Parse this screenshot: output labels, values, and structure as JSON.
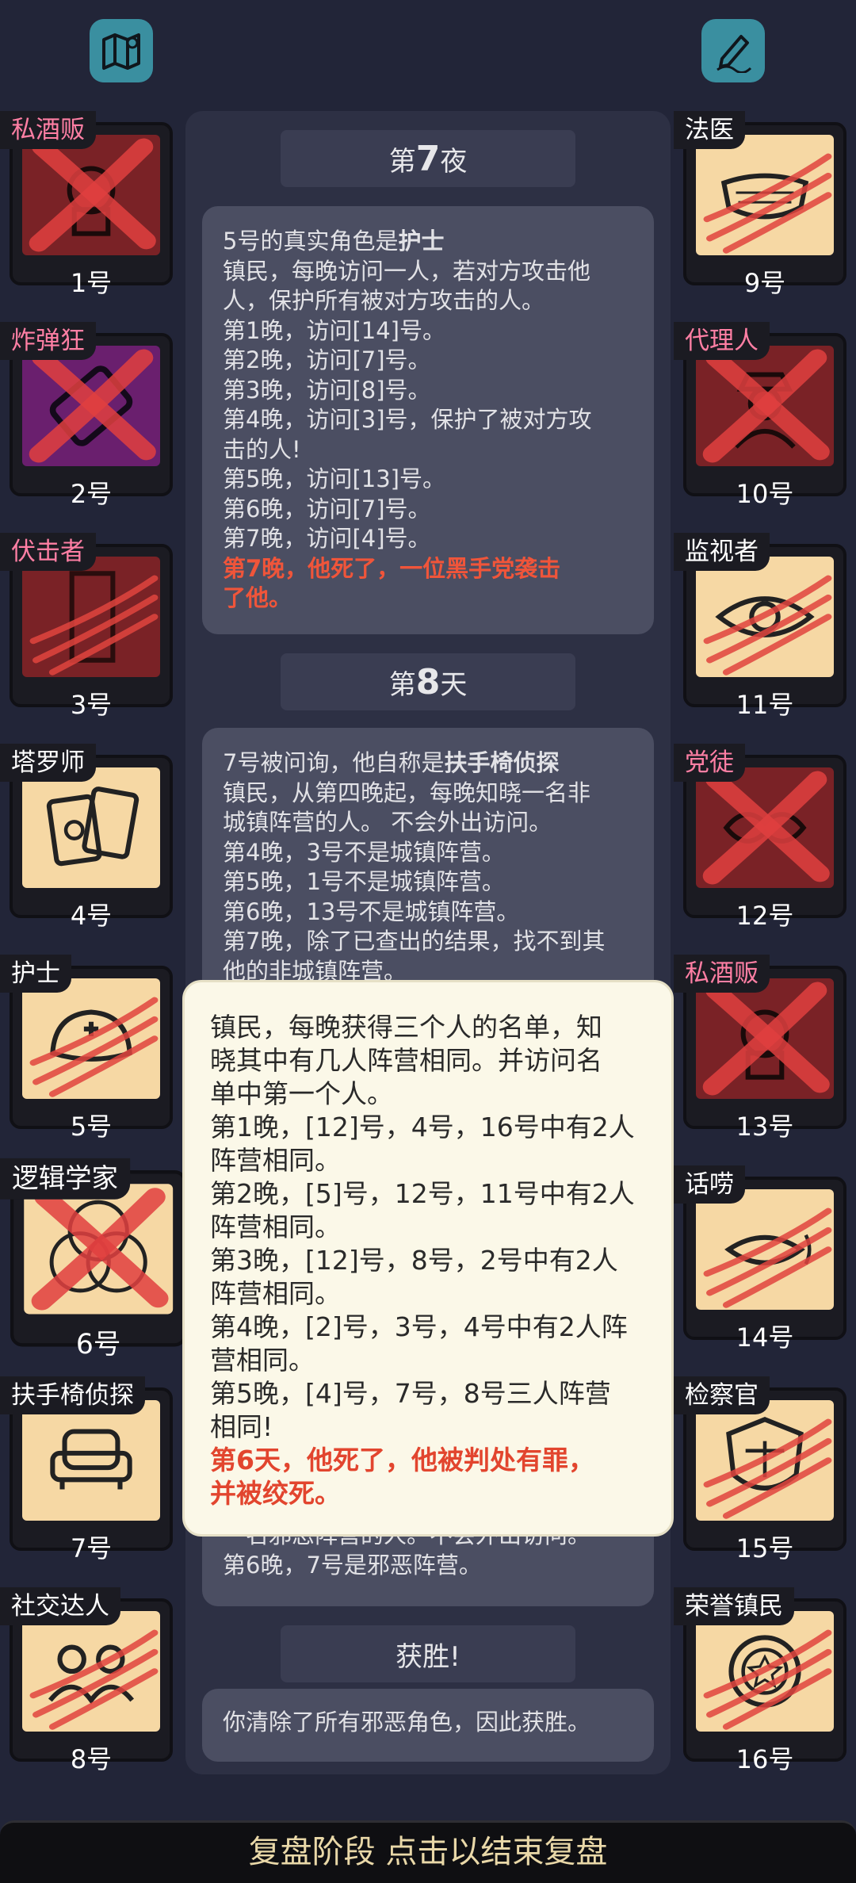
{
  "top": {
    "map_icon": "map-icon",
    "notes_icon": "pencil-icon"
  },
  "sections": [
    {
      "prefix": "第",
      "num": "7",
      "suffix": "夜"
    },
    {
      "prefix": "第",
      "num": "8",
      "suffix": "天"
    },
    {
      "title": "获胜!"
    }
  ],
  "night7": {
    "head_pre": "5号的真实角色是",
    "head_role": "护士",
    "lines": [
      "镇民，每晚访问一人，若对方攻击他",
      "人，保护所有被对方攻击的人。",
      "第1晚，访问[14]号。",
      "第2晚，访问[7]号。",
      "第3晚，访问[8]号。",
      "第4晚，访问[3]号，保护了被对方攻",
      "击的人!",
      "第5晚，访问[13]号。",
      "第6晚，访问[7]号。",
      "第7晚，访问[4]号。"
    ],
    "red": [
      "第7晚，他死了，一位黑手党袭击",
      "了他。"
    ]
  },
  "day8": {
    "head_pre": "7号被问询，他自称是",
    "head_role": "扶手椅侦探",
    "lines": [
      "镇民，从第四晚起，每晚知晓一名非",
      "城镇阵营的人。 不会外出访问。",
      "第4晚，3号不是城镇阵营。",
      "第5晚，1号不是城镇阵营。",
      "第6晚，13号不是城镇阵营。",
      "第7晚，除了已查出的结果，找不到其",
      "他的非城镇阵营。"
    ],
    "tail": [
      "一名邪恶阵营的人。不会外出访问。",
      "第6晚，7号是邪恶阵营。"
    ]
  },
  "victory": {
    "text": "你清除了所有邪恶角色，因此获胜。"
  },
  "popup": {
    "lines": [
      "镇民，每晚获得三个人的名单，知",
      "晓其中有几人阵营相同。并访问名",
      "单中第一个人。",
      "第1晚，[12]号，4号，16号中有2人",
      "阵营相同。",
      "第2晚，[5]号，12号，11号中有2人",
      "阵营相同。",
      "第3晚，[12]号，8号，2号中有2人",
      "阵营相同。",
      "第4晚，[2]号，3号，4号中有2人阵",
      "营相同。",
      "第5晚，[4]号，7号，8号三人阵营",
      "相同!"
    ],
    "red": [
      "第6天，他死了，他被判处有罪，",
      "并被绞死。"
    ]
  },
  "players_left": [
    {
      "role": "私酒贩",
      "num": "1号",
      "bg": "maroon",
      "tag": "pink",
      "mark": "x",
      "icon": "bootlegger-icon"
    },
    {
      "role": "炸弹狂",
      "num": "2号",
      "bg": "purple",
      "tag": "pink",
      "mark": "x",
      "icon": "bomb-icon"
    },
    {
      "role": "伏击者",
      "num": "3号",
      "bg": "maroon",
      "tag": "pink",
      "mark": "claw",
      "icon": "ambush-icon"
    },
    {
      "role": "塔罗师",
      "num": "4号",
      "bg": "cream",
      "tag": "white",
      "mark": "none",
      "icon": "tarot-cards-icon"
    },
    {
      "role": "护士",
      "num": "5号",
      "bg": "cream",
      "tag": "white",
      "mark": "claw",
      "icon": "nurse-cap-icon"
    },
    {
      "role": "逻辑学家",
      "num": "6号",
      "bg": "cream",
      "tag": "white",
      "mark": "x",
      "icon": "venn-diagram-icon"
    },
    {
      "role": "扶手椅侦探",
      "num": "7号",
      "bg": "cream",
      "tag": "white",
      "mark": "none",
      "icon": "armchair-icon"
    },
    {
      "role": "社交达人",
      "num": "8号",
      "bg": "cream",
      "tag": "white",
      "mark": "claw",
      "icon": "people-icon"
    }
  ],
  "players_right": [
    {
      "role": "法医",
      "num": "9号",
      "bg": "cream",
      "tag": "white",
      "mark": "claw",
      "icon": "mask-icon"
    },
    {
      "role": "代理人",
      "num": "10号",
      "bg": "maroon",
      "tag": "pink",
      "mark": "x",
      "icon": "agent-icon"
    },
    {
      "role": "监视者",
      "num": "11号",
      "bg": "cream",
      "tag": "white",
      "mark": "claw",
      "icon": "eye-icon"
    },
    {
      "role": "党徒",
      "num": "12号",
      "bg": "maroon",
      "tag": "pink",
      "mark": "x",
      "icon": "handshake-icon"
    },
    {
      "role": "私酒贩",
      "num": "13号",
      "bg": "maroon",
      "tag": "pink",
      "mark": "x",
      "icon": "bootlegger-icon"
    },
    {
      "role": "话唠",
      "num": "14号",
      "bg": "cream",
      "tag": "white",
      "mark": "claw",
      "icon": "mouth-icon"
    },
    {
      "role": "检察官",
      "num": "15号",
      "bg": "cream",
      "tag": "white",
      "mark": "claw",
      "icon": "scales-badge-icon"
    },
    {
      "role": "荣誉镇民",
      "num": "16号",
      "bg": "cream",
      "tag": "white",
      "mark": "claw",
      "icon": "medal-icon"
    }
  ],
  "bottom": {
    "label": "复盘阶段 点击以结束复盘"
  }
}
